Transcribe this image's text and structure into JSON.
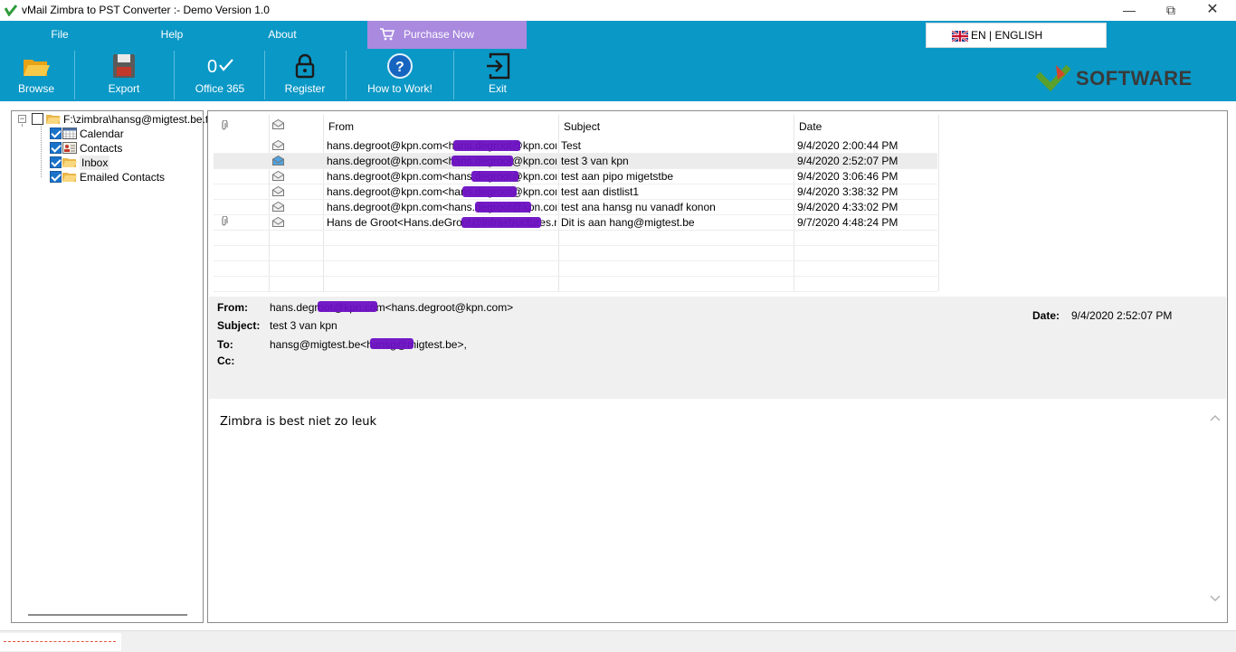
{
  "window": {
    "title": "vMail Zimbra to PST Converter  :- Demo Version 1.0",
    "min_glyph": "—",
    "max_glyph": "⧉",
    "close_glyph": "✕"
  },
  "menu": {
    "file": "File",
    "help": "Help",
    "about": "About",
    "purchase": "Purchase Now",
    "language": "EN | ENGLISH"
  },
  "toolbar": {
    "browse": "Browse",
    "export": "Export",
    "office365": "Office 365",
    "register": "Register",
    "how_to_work": "How to Work!",
    "exit": "Exit",
    "brand": "SOFTWARE"
  },
  "tree": {
    "root": "F:\\zimbra\\hansg@migtest.be.tgz",
    "items": [
      {
        "label": "Calendar",
        "icon": "calendar-icon",
        "checked": true
      },
      {
        "label": "Contacts",
        "icon": "contacts-icon",
        "checked": true
      },
      {
        "label": "Inbox",
        "icon": "folder-icon",
        "checked": true
      },
      {
        "label": "Emailed Contacts",
        "icon": "folder-icon",
        "checked": true
      }
    ]
  },
  "grid": {
    "columns": [
      "From",
      "Subject",
      "Date"
    ],
    "rows": [
      {
        "attach": false,
        "from": "hans.degroot@kpn.com<hans.degroot@kpn.com>",
        "subject": "Test",
        "date": "9/4/2020 2:00:44 PM"
      },
      {
        "attach": false,
        "from": "hans.degroot@kpn.com<hans.degroot@kpn.com>",
        "subject": "test 3 van kpn",
        "date": "9/4/2020 2:52:07 PM",
        "selected": true
      },
      {
        "attach": false,
        "from": "hans.degroot@kpn.com<hans.degroot@kpn.com>",
        "subject": "test aan pipo migetstbe",
        "date": "9/4/2020 3:06:46 PM"
      },
      {
        "attach": false,
        "from": "hans.degroot@kpn.com<hans.degroot@kpn.com>",
        "subject": "test aan distlist1",
        "date": "9/4/2020 3:38:32 PM"
      },
      {
        "attach": false,
        "from": "hans.degroot@kpn.com<hans.degroot@kpn.com>",
        "subject": "test ana hansg nu vanadf konon",
        "date": "9/4/2020 4:33:02 PM"
      },
      {
        "attach": true,
        "from": "Hans de Groot<Hans.deGroot@infrastructures.nl>",
        "subject": "Dit is aan hang@migtest.be",
        "date": "9/7/2020 4:48:24 PM"
      }
    ]
  },
  "message": {
    "from_label": "From:",
    "from_value": "hans.degroot@kpn.com<hans.degroot@kpn.com>",
    "subject_label": "Subject:",
    "subject_value": "test 3 van kpn",
    "to_label": "To:",
    "to_value": "hansg@migtest.be<hansg@migtest.be>,",
    "cc_label": "Cc:",
    "date_label": "Date:",
    "date_value": "9/4/2020 2:52:07 PM",
    "body": "Zimbra is best niet zo leuk"
  },
  "colors": {
    "accent": "#0a98c6",
    "purchase": "#a98adf",
    "redaction": "#6b0fc2"
  }
}
